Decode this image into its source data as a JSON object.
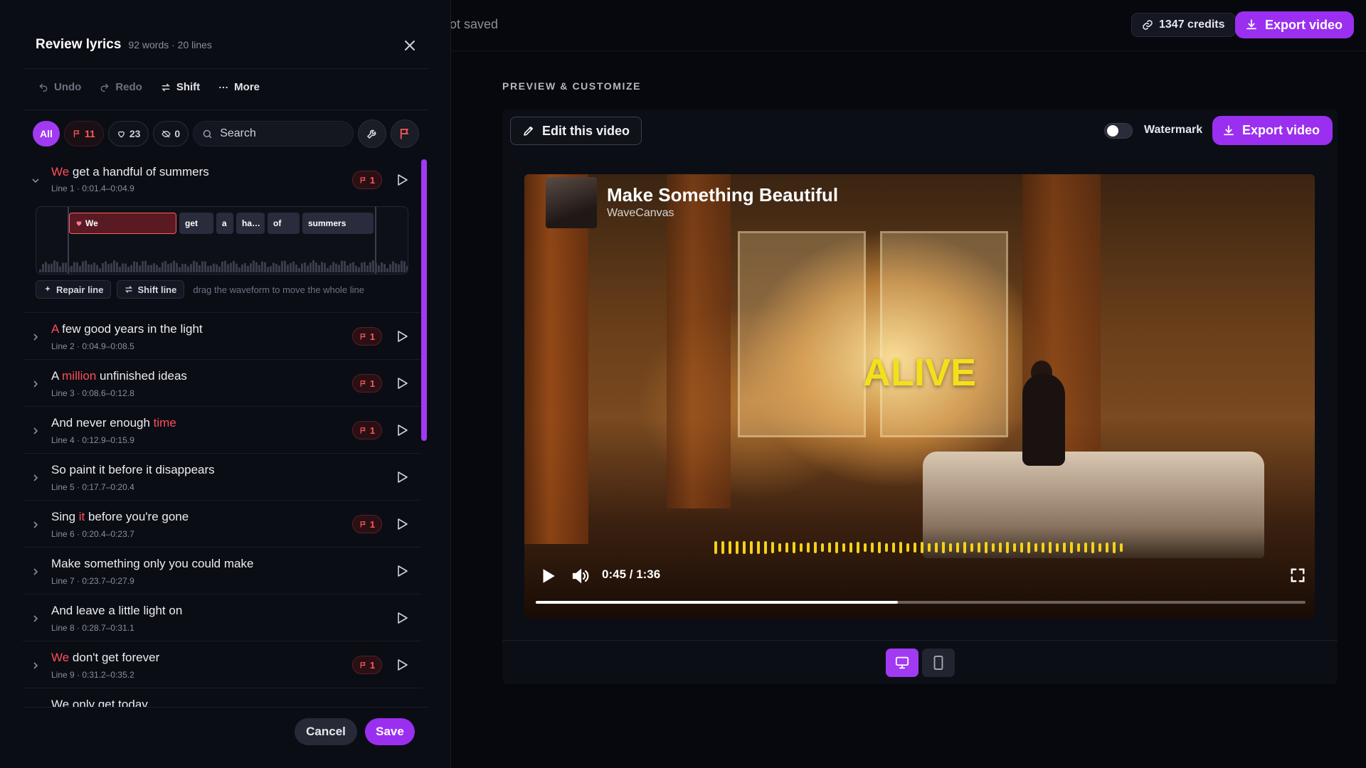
{
  "app": {
    "save_status": "ot saved",
    "credits_label": "1347 credits",
    "export_label": "Export video"
  },
  "panel": {
    "title": "Review lyrics",
    "subtitle": "92 words · 20 lines",
    "toolbar": {
      "undo": "Undo",
      "redo": "Redo",
      "shift": "Shift",
      "more": "More"
    },
    "filters": {
      "all": "All",
      "flagged": "11",
      "liked": "23",
      "hidden": "0",
      "search_placeholder": "Search"
    },
    "expanded": {
      "pre": "We",
      "post": " get a handful of summers",
      "meta": "Line 1 · 0:01.4–0:04.9",
      "flags": "1",
      "words": [
        "We",
        "get",
        "a",
        "ha…",
        "of",
        "summers"
      ],
      "repair_label": "Repair line",
      "shift_label": "Shift line",
      "hint": "drag the waveform to move the whole line"
    },
    "lines": [
      {
        "pre": "",
        "hl": "A",
        "post": " few good years in the light",
        "meta": "Line 2 · 0:04.9–0:08.5",
        "flags": "1"
      },
      {
        "pre": "A ",
        "hl": "million",
        "post": " unfinished ideas",
        "meta": "Line 3 · 0:08.6–0:12.8",
        "flags": "1"
      },
      {
        "pre": "And never enough ",
        "hl": "time",
        "post": "",
        "meta": "Line 4 · 0:12.9–0:15.9",
        "flags": "1"
      },
      {
        "pre": "So paint it before it disappears",
        "hl": "",
        "post": "",
        "meta": "Line 5 · 0:17.7–0:20.4",
        "flags": ""
      },
      {
        "pre": "Sing ",
        "hl": "it",
        "post": " before you're gone",
        "meta": "Line 6 · 0:20.4–0:23.7",
        "flags": "1"
      },
      {
        "pre": "Make something only you could make",
        "hl": "",
        "post": "",
        "meta": "Line 7 · 0:23.7–0:27.9",
        "flags": ""
      },
      {
        "pre": "And leave a little light on",
        "hl": "",
        "post": "",
        "meta": "Line 8 · 0:28.7–0:31.1",
        "flags": ""
      },
      {
        "pre": "",
        "hl": "We",
        "post": " don't get forever",
        "meta": "Line 9 · 0:31.2–0:35.2",
        "flags": "1"
      },
      {
        "pre": "We only get today",
        "hl": "",
        "post": "",
        "meta": "",
        "flags": ""
      }
    ],
    "cancel_label": "Cancel",
    "save_label": "Save"
  },
  "preview": {
    "section_label": "PREVIEW & CUSTOMIZE",
    "edit_label": "Edit this video",
    "watermark_label": "Watermark",
    "watermark_on": false,
    "export_label": "Export video",
    "video": {
      "title": "Make Something Beautiful",
      "artist": "WaveCanvas",
      "lyric": "ALIVE",
      "time": "0:45 / 1:36",
      "progress": 0.47
    }
  },
  "colors": {
    "accent": "#9b2ff0",
    "flag": "#ff4d5a",
    "lyric": "#f4e01a"
  }
}
